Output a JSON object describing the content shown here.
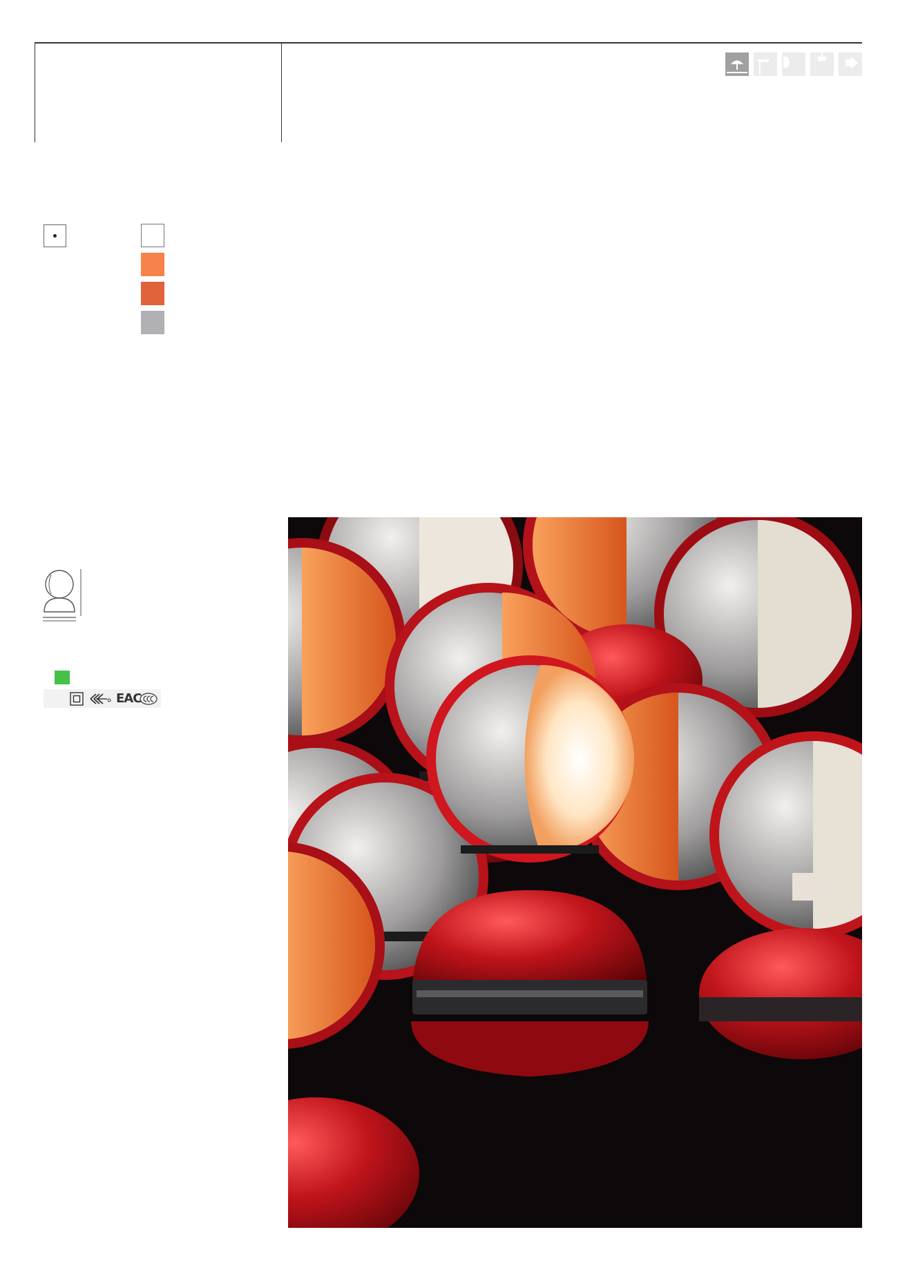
{
  "typology_icons": [
    {
      "name": "table-lamp-icon",
      "active": true
    },
    {
      "name": "floor-lamp-icon",
      "active": false
    },
    {
      "name": "wall-lamp-icon",
      "active": false
    },
    {
      "name": "suspension-lamp-icon",
      "active": false
    },
    {
      "name": "outdoor-lamp-icon",
      "active": false
    }
  ],
  "finish_colors": [
    "#ffffff",
    "#f5834a",
    "#e0633b",
    "#b1b1b5"
  ],
  "energy_class_color": "#45c145",
  "certification_marks": [
    "EAC"
  ],
  "photo": {
    "subject": "red-table-lamps-photo",
    "background": "#0d0809",
    "base_color": "#c0141b",
    "accent_color": "#f07a2c"
  }
}
